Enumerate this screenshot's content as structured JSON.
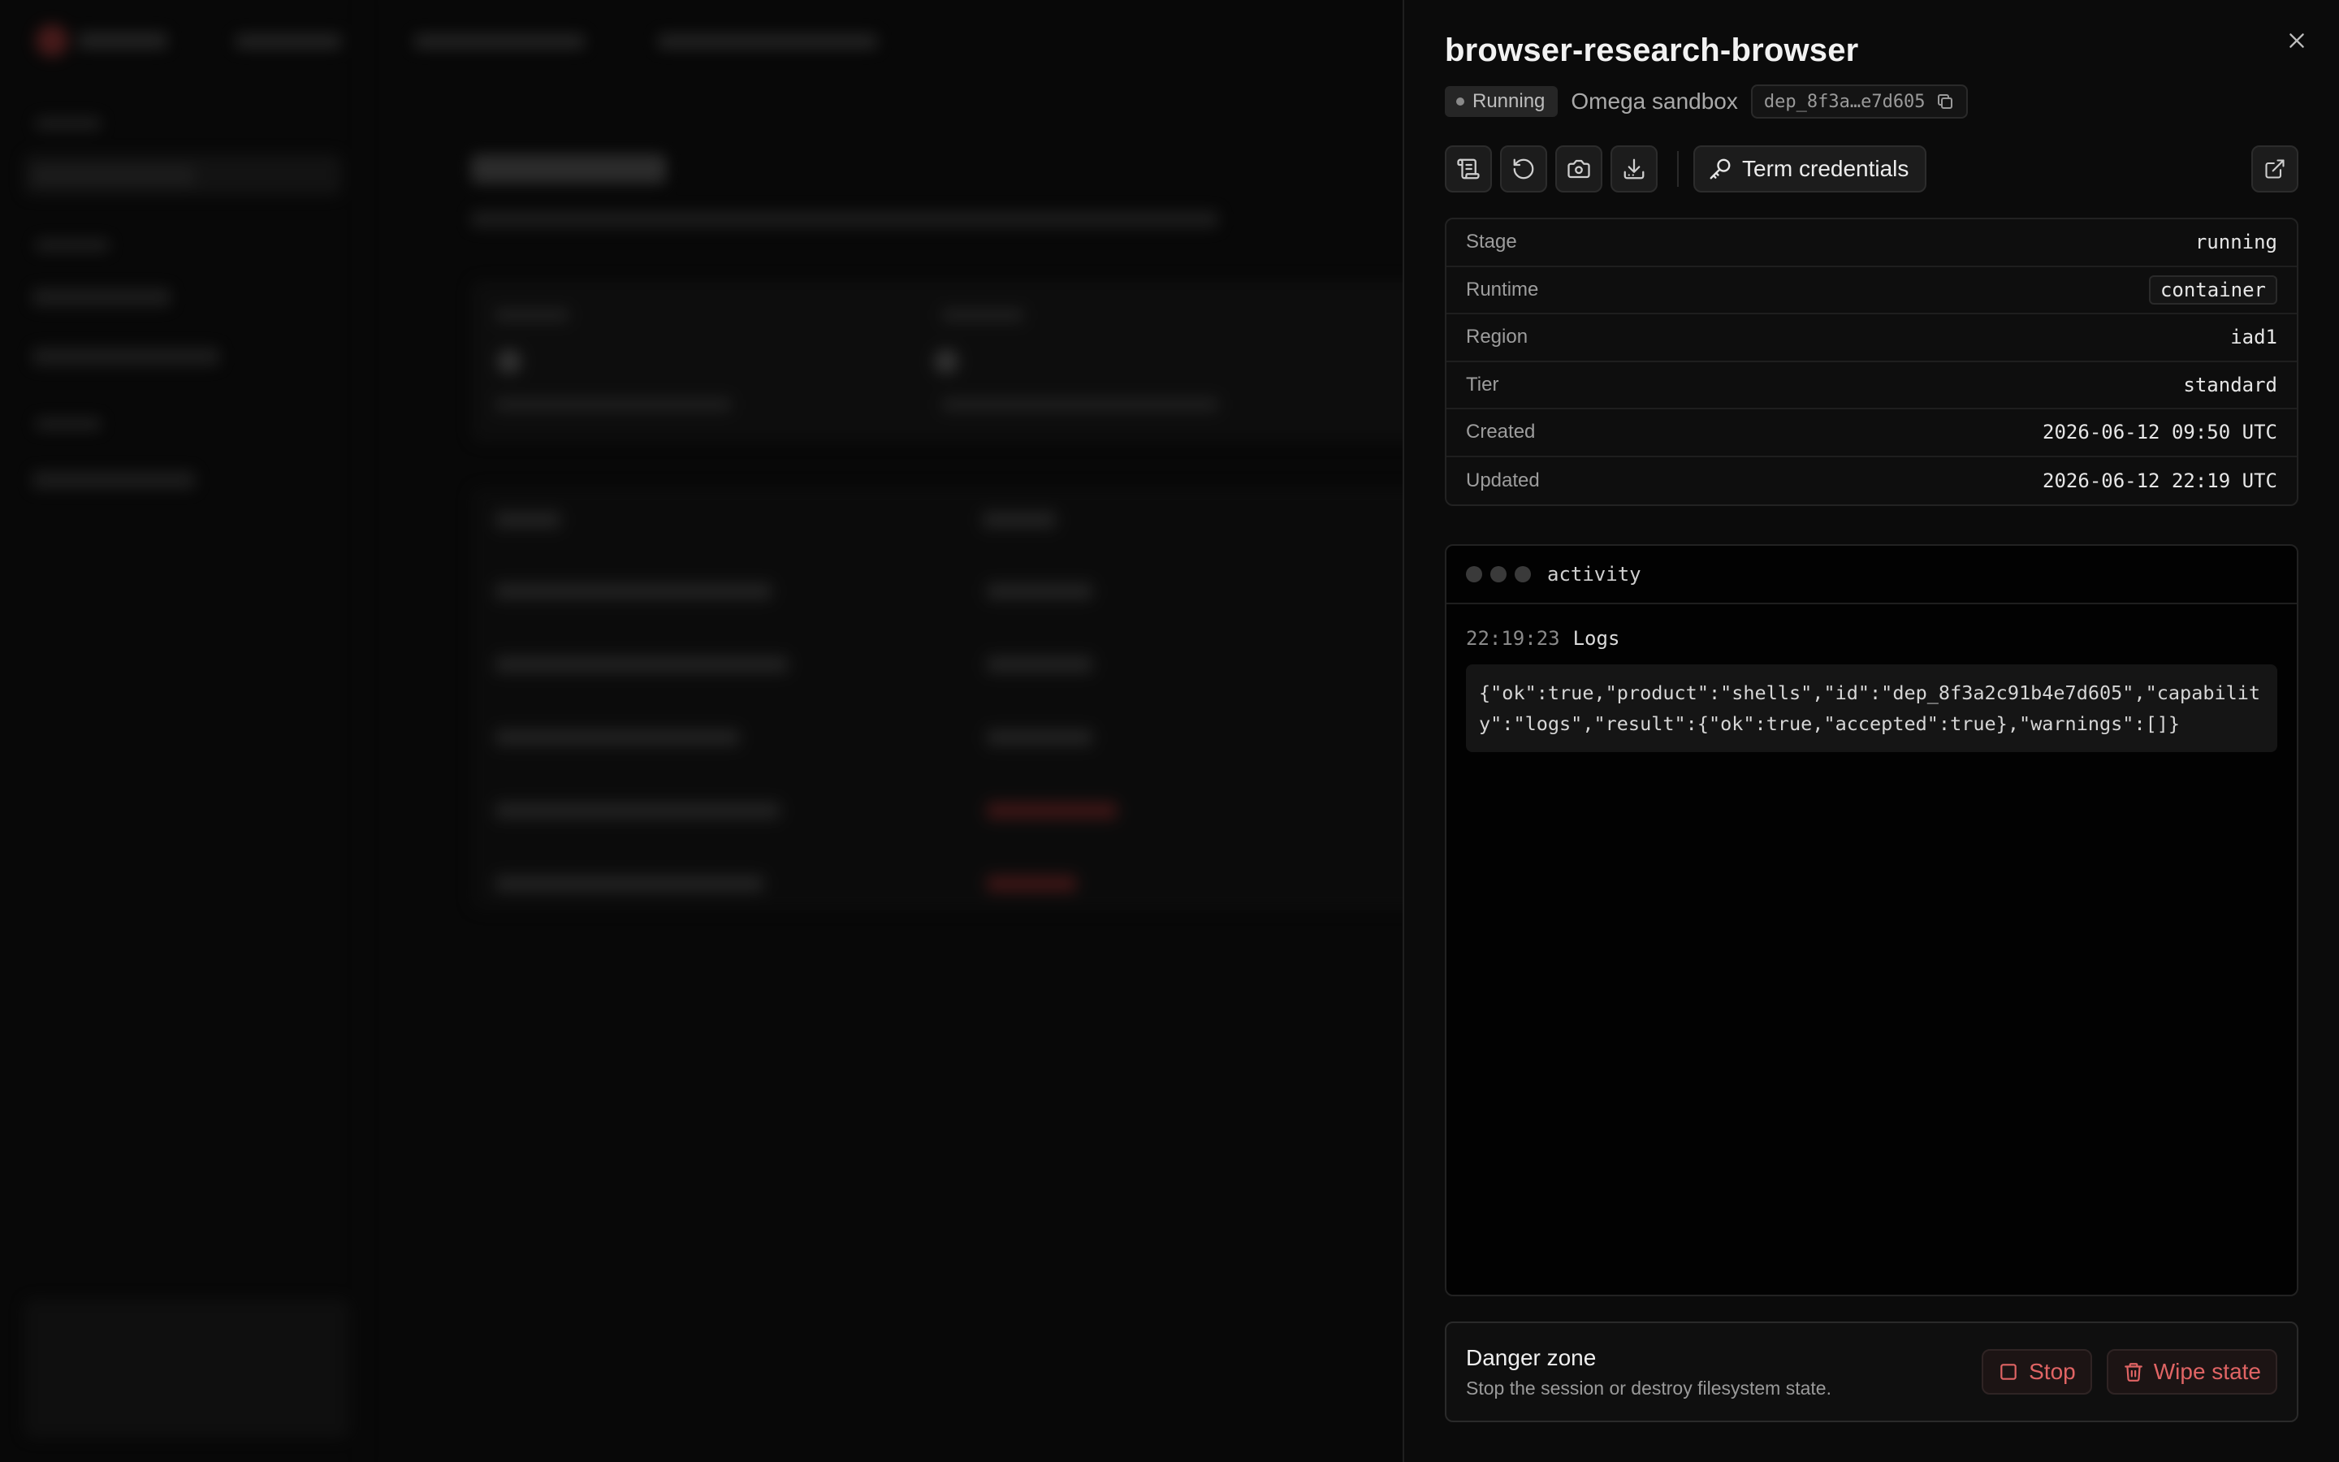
{
  "drawer": {
    "title": "browser-research-browser",
    "status": "Running",
    "environment": "Omega sandbox",
    "deployment_id": "dep_8f3a…e7d605",
    "toolbar": {
      "icons": [
        "logs-icon",
        "restart-icon",
        "camera-icon",
        "download-icon"
      ],
      "credentials_label": "Term credentials"
    },
    "properties": [
      {
        "label": "Stage",
        "value": "running"
      },
      {
        "label": "Runtime",
        "value": "container"
      },
      {
        "label": "Region",
        "value": "iad1"
      },
      {
        "label": "Tier",
        "value": "standard"
      },
      {
        "label": "Created",
        "value": "2026-06-12 09:50 UTC"
      },
      {
        "label": "Updated",
        "value": "2026-06-12 22:19 UTC"
      }
    ],
    "activity": {
      "title": "activity",
      "entries": [
        {
          "time": "22:19:23",
          "kind": "Logs",
          "body": "{\"ok\":true,\"product\":\"shells\",\"id\":\"dep_8f3a2c91b4e7d605\",\"capability\":\"logs\",\"result\":{\"ok\":true,\"accepted\":true},\"warnings\":[]}"
        }
      ]
    },
    "danger_zone": {
      "title": "Danger zone",
      "description": "Stop the session or destroy filesystem state.",
      "stop_label": "Stop",
      "wipe_label": "Wipe state"
    }
  },
  "colors": {
    "background": "#050505",
    "panel": "#0b0b0b",
    "danger": "#e06464",
    "text": "#e8e8e8"
  }
}
